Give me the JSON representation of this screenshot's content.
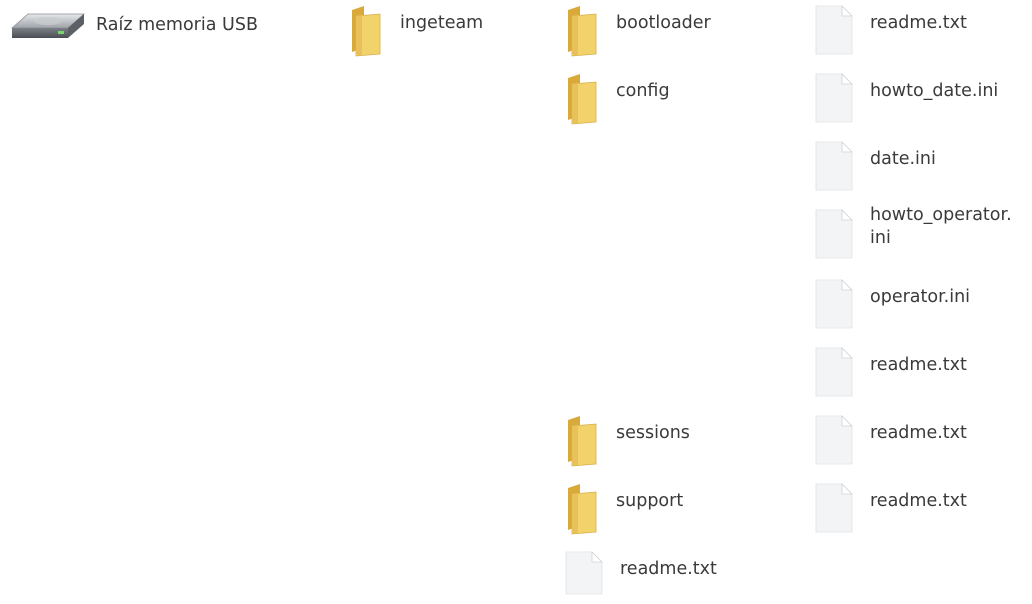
{
  "tree": {
    "root": {
      "label": "Raíz memoria USB",
      "icon": "usb-drive-icon"
    },
    "ingeteam": {
      "label": "ingeteam",
      "icon": "folder-icon"
    },
    "bootloader": {
      "label": "bootloader",
      "icon": "folder-icon",
      "files": [
        {
          "label": "readme.txt",
          "icon": "text-file-icon"
        }
      ]
    },
    "config": {
      "label": "config",
      "icon": "folder-icon",
      "files": [
        {
          "label": "howto_date.ini",
          "icon": "text-file-icon"
        },
        {
          "label": "date.ini",
          "icon": "text-file-icon"
        },
        {
          "label": "howto_operator.\nini",
          "icon": "text-file-icon"
        },
        {
          "label": "operator.ini",
          "icon": "text-file-icon"
        },
        {
          "label": "readme.txt",
          "icon": "text-file-icon"
        }
      ]
    },
    "sessions": {
      "label": "sessions",
      "icon": "folder-icon",
      "files": [
        {
          "label": "readme.txt",
          "icon": "text-file-icon"
        }
      ]
    },
    "support": {
      "label": "support",
      "icon": "folder-icon",
      "files": [
        {
          "label": "readme.txt",
          "icon": "text-file-icon"
        }
      ]
    },
    "ingeteam_files": [
      {
        "label": "readme.txt",
        "icon": "text-file-icon"
      }
    ]
  },
  "colors": {
    "folder_front": "#f2d26a",
    "folder_back": "#d9a93a",
    "file_page": "#f3f4f6",
    "file_fold": "#ffffff",
    "text": "#3a3a3a"
  }
}
